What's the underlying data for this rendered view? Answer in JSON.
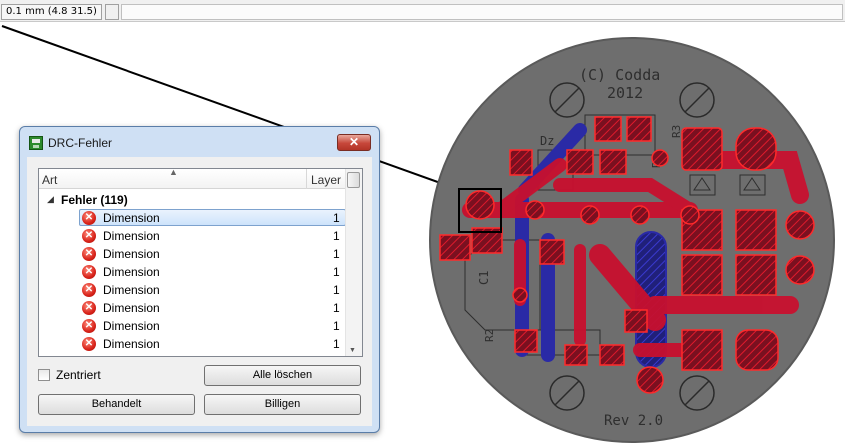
{
  "statusbar": {
    "coordinate": "0.1 mm (4.8 31.5)"
  },
  "board": {
    "copyright": "(C) Codda",
    "year": "2012",
    "revision": "Rev 2.0",
    "labels": [
      "Dz",
      "R3",
      "R1",
      "C1",
      "R2"
    ]
  },
  "dialog": {
    "title": "DRC-Fehler",
    "close_symbol": "✕",
    "columns": {
      "art": "Art",
      "layer": "Layer"
    },
    "group": {
      "label": "Fehler (119)"
    },
    "rows": [
      {
        "name": "Dimension",
        "layer": "1"
      },
      {
        "name": "Dimension",
        "layer": "1"
      },
      {
        "name": "Dimension",
        "layer": "1"
      },
      {
        "name": "Dimension",
        "layer": "1"
      },
      {
        "name": "Dimension",
        "layer": "1"
      },
      {
        "name": "Dimension",
        "layer": "1"
      },
      {
        "name": "Dimension",
        "layer": "1"
      },
      {
        "name": "Dimension",
        "layer": "1"
      }
    ],
    "checkbox_label": "Zentriert",
    "buttons": {
      "alle_loeschen": "Alle löschen",
      "behandelt": "Behandelt",
      "billigen": "Billigen"
    }
  },
  "colors": {
    "board_fill": "#6e6e6e",
    "copper_top": "#c8102e",
    "copper_bottom": "#2a2aa6",
    "silkscreen": "#a0a0a0",
    "error_marker": "#000000"
  },
  "icons": [
    "app-board-icon",
    "close-icon",
    "sort-up-icon",
    "expand-arrow-icon",
    "error-icon",
    "scroll-down-icon"
  ]
}
